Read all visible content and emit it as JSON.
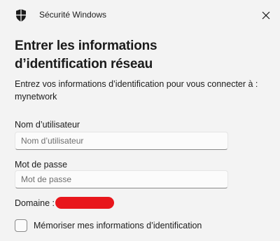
{
  "window": {
    "app_title": "Sécurité Windows",
    "icons": {
      "app": "shield-icon",
      "close": "close-icon"
    }
  },
  "dialog": {
    "heading": "Entrer les informations d’identification réseau",
    "description": "Entrez vos informations d’identification pour vous connecter à : mynetwork",
    "username": {
      "label": "Nom d’utilisateur",
      "placeholder": "Nom d’utilisateur",
      "value": ""
    },
    "password": {
      "label": "Mot de passe",
      "placeholder": "Mot de passe",
      "value": ""
    },
    "domain": {
      "label": "Domaine :",
      "value_redacted": true
    },
    "remember": {
      "label": "Mémoriser mes informations d’identification",
      "checked": false
    }
  },
  "colors": {
    "background": "#f3f3f3",
    "text": "#1b1b1b",
    "redaction": "#e8161b"
  }
}
